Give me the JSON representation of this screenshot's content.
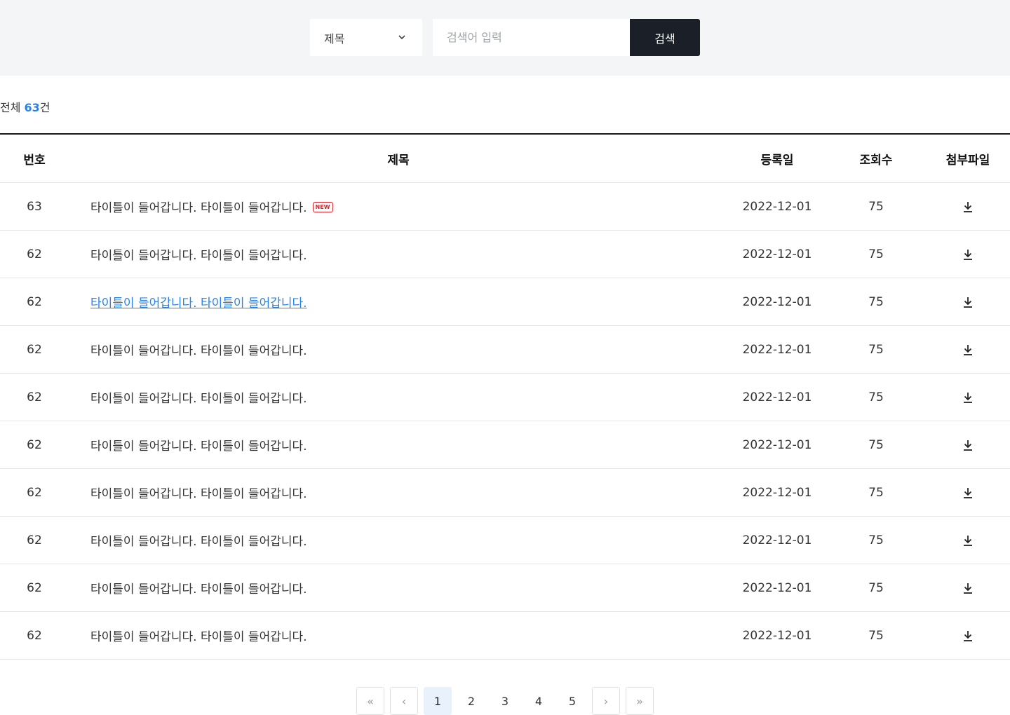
{
  "search": {
    "select_value": "제목",
    "placeholder": "검색어 입력",
    "button_label": "검색"
  },
  "summary": {
    "prefix": "전체 ",
    "count": "63",
    "suffix": "건"
  },
  "table": {
    "headers": {
      "no": "번호",
      "title": "제목",
      "date": "등록일",
      "views": "조회수",
      "file": "첨부파일"
    },
    "rows": [
      {
        "no": "63",
        "title": "타이틀이 들어갑니다. 타이틀이 들어갑니다.",
        "badge": "NEW",
        "date": "2022-12-01",
        "views": "75"
      },
      {
        "no": "62",
        "title": "타이틀이 들어갑니다. 타이틀이 들어갑니다.",
        "date": "2022-12-01",
        "views": "75"
      },
      {
        "no": "62",
        "title": "타이틀이 들어갑니다. 타이틀이 들어갑니다.",
        "date": "2022-12-01",
        "views": "75"
      },
      {
        "no": "62",
        "title": "타이틀이 들어갑니다. 타이틀이 들어갑니다.",
        "date": "2022-12-01",
        "views": "75"
      },
      {
        "no": "62",
        "title": "타이틀이 들어갑니다. 타이틀이 들어갑니다.",
        "date": "2022-12-01",
        "views": "75"
      },
      {
        "no": "62",
        "title": "타이틀이 들어갑니다. 타이틀이 들어갑니다.",
        "date": "2022-12-01",
        "views": "75"
      },
      {
        "no": "62",
        "title": "타이틀이 들어갑니다. 타이틀이 들어갑니다.",
        "date": "2022-12-01",
        "views": "75"
      },
      {
        "no": "62",
        "title": "타이틀이 들어갑니다. 타이틀이 들어갑니다.",
        "date": "2022-12-01",
        "views": "75"
      },
      {
        "no": "62",
        "title": "타이틀이 들어갑니다. 타이틀이 들어갑니다.",
        "date": "2022-12-01",
        "views": "75"
      },
      {
        "no": "62",
        "title": "타이틀이 들어갑니다. 타이틀이 들어갑니다.",
        "date": "2022-12-01",
        "views": "75"
      }
    ]
  },
  "pagination": {
    "first": "«",
    "prev": "‹",
    "pages": [
      "1",
      "2",
      "3",
      "4",
      "5"
    ],
    "next": "›",
    "last": "»",
    "current": "1"
  },
  "colors": {
    "accent": "#2a82e4",
    "button_dark": "#1a1f28",
    "new_badge": "#d8242a",
    "search_bg": "#f4f5f7"
  },
  "icons": {
    "select": "chevron-down-icon",
    "file": "download-icon"
  }
}
